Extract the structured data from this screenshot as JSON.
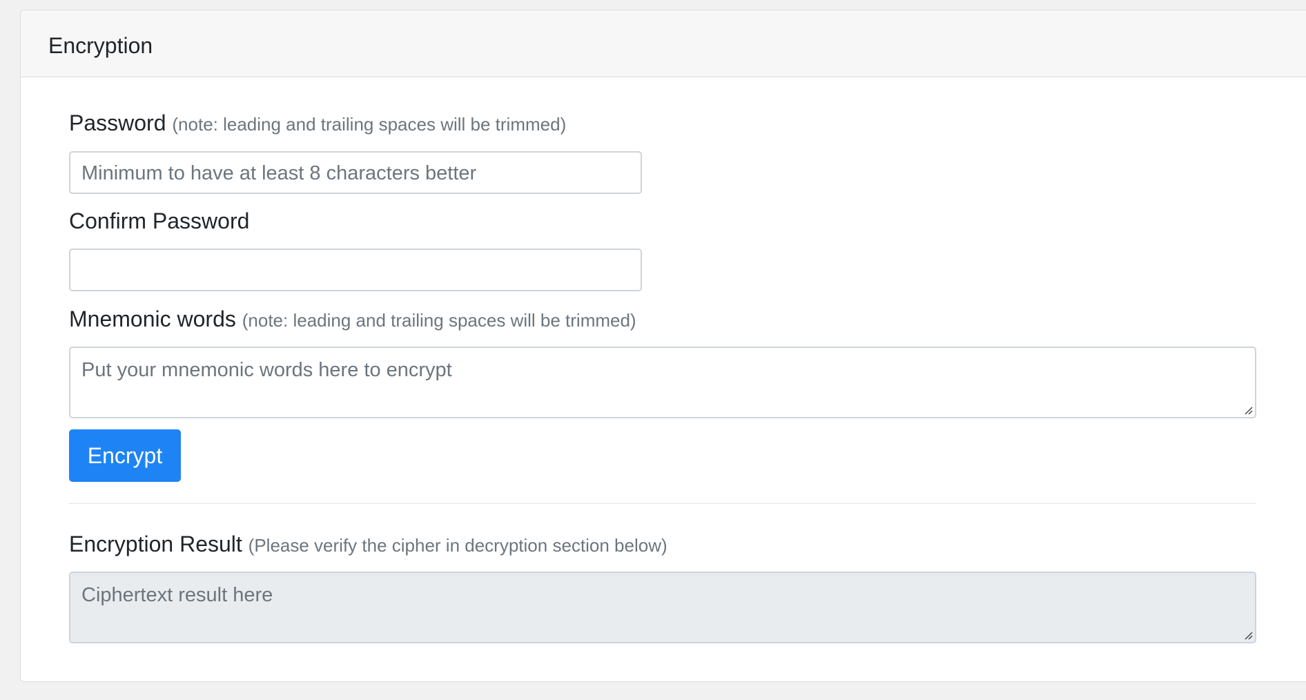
{
  "card": {
    "title": "Encryption"
  },
  "password": {
    "label": "Password",
    "note": "(note: leading and trailing spaces will be trimmed)",
    "placeholder": "Minimum to have at least 8 characters better"
  },
  "confirm_password": {
    "label": "Confirm Password",
    "placeholder": ""
  },
  "mnemonic": {
    "label": "Mnemonic words",
    "note": "(note: leading and trailing spaces will be trimmed)",
    "placeholder": "Put your mnemonic words here to encrypt"
  },
  "encrypt_button": {
    "label": "Encrypt",
    "color": "#1e84f5"
  },
  "result": {
    "label": "Encryption Result",
    "note": "(Please verify the cipher in decryption section below)",
    "placeholder": "Ciphertext result here"
  }
}
